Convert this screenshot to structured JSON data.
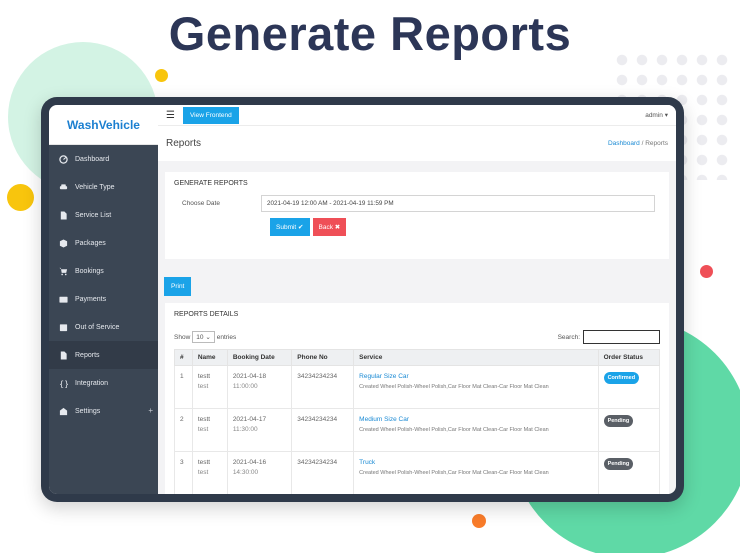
{
  "headline": "Generate Reports",
  "sidebar": {
    "brand": "WashVehicle",
    "items": [
      {
        "label": "Dashboard",
        "icon": "dashboard-icon"
      },
      {
        "label": "Vehicle Type",
        "icon": "car-icon"
      },
      {
        "label": "Service List",
        "icon": "file-icon"
      },
      {
        "label": "Packages",
        "icon": "box-icon"
      },
      {
        "label": "Bookings",
        "icon": "cart-icon"
      },
      {
        "label": "Payments",
        "icon": "card-icon"
      },
      {
        "label": "Out of Service",
        "icon": "calendar-icon"
      },
      {
        "label": "Reports",
        "icon": "file-icon"
      },
      {
        "label": "Integration",
        "icon": "braces-icon"
      },
      {
        "label": "Settings",
        "icon": "building-icon",
        "plus": "+"
      }
    ],
    "active_index": 7
  },
  "topbar": {
    "menu_icon": "hamburger-icon",
    "frontend_button": "View Frontend",
    "user": "admin"
  },
  "page": {
    "title": "Reports",
    "breadcrumb": {
      "home": "Dashboard",
      "separator": "/",
      "current": "Reports"
    }
  },
  "generate": {
    "title": "GENERATE REPORTS",
    "date_label": "Choose Date",
    "date_value": "2021-04-19 12:00 AM - 2021-04-19 11:59 PM",
    "submit_label": "Submit",
    "back_label": "Back"
  },
  "print_label": "Print",
  "report": {
    "title": "REPORTS DETAILS",
    "show_label": "Show",
    "entries_value": "10",
    "entries_label": "entries",
    "search_label": "Search:",
    "columns": [
      "#",
      "Name",
      "Booking Date",
      "Phone No",
      "Service",
      "Order Status"
    ],
    "rows": [
      {
        "num": "1",
        "name": "testt",
        "sub": "test",
        "date": "2021-04-18",
        "time": "11:00:00",
        "phone": "34234234234",
        "service": "Regular Size Car",
        "desc": "Created Wheel Polish-Wheel Polish,Car Floor Mat Clean-Car Floor Mat Clean",
        "status": "Confirmed"
      },
      {
        "num": "2",
        "name": "testt",
        "sub": "test",
        "date": "2021-04-17",
        "time": "11:30:00",
        "phone": "34234234234",
        "service": "Medium Size Car",
        "desc": "Created Wheel Polish-Wheel Polish,Car Floor Mat Clean-Car Floor Mat Clean",
        "status": "Pending"
      },
      {
        "num": "3",
        "name": "testt",
        "sub": "test",
        "date": "2021-04-16",
        "time": "14:30:00",
        "phone": "34234234234",
        "service": "Truck",
        "desc": "Created Wheel Polish-Wheel Polish,Car Floor Mat Clean-Car Floor Mat Clean",
        "status": "Pending"
      }
    ]
  },
  "colors": {
    "accent": "#1aa3e8",
    "danger": "#ef4f57",
    "sidebar": "#3b4654",
    "headline": "#2c3657"
  }
}
